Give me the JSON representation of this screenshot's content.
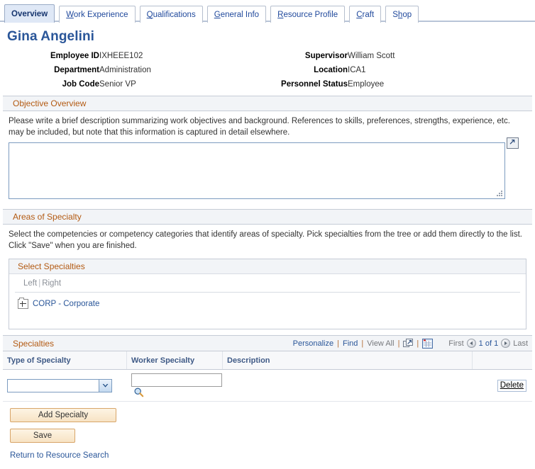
{
  "tabs": [
    {
      "label": "Overview",
      "accesskey_index": -1,
      "selected": true
    },
    {
      "label": "Work Experience",
      "accesskey_index": 0,
      "selected": false
    },
    {
      "label": "Qualifications",
      "accesskey_index": 0,
      "selected": false
    },
    {
      "label": "General Info",
      "accesskey_index": 0,
      "selected": false
    },
    {
      "label": "Resource Profile",
      "accesskey_index": 0,
      "selected": false
    },
    {
      "label": "Craft",
      "accesskey_index": 0,
      "selected": false
    },
    {
      "label": "Shop",
      "accesskey_index": 1,
      "selected": false
    }
  ],
  "page": {
    "title": "Gina Angelini"
  },
  "employee_info": {
    "left": [
      {
        "label": "Employee ID",
        "value": "IXHEEE102"
      },
      {
        "label": "Department",
        "value": "Administration"
      },
      {
        "label": "Job Code",
        "value": "Senior VP"
      }
    ],
    "right": [
      {
        "label": "Supervisor",
        "value": "William Scott"
      },
      {
        "label": "Location",
        "value": "ICA1"
      },
      {
        "label": "Personnel Status",
        "value": "Employee"
      }
    ]
  },
  "objective": {
    "header": "Objective Overview",
    "instructions": "Please write a brief description summarizing work objectives and background. References to skills, preferences, strengths, experience, etc. may be included, but note that this information is captured in detail elsewhere.",
    "textarea_value": "",
    "expand_icon": "expand-window-icon"
  },
  "areas_of_specialty": {
    "header": "Areas of Specialty",
    "instructions": "Select the competencies or competency categories that identify areas of specialty. Pick specialties from the tree or add them directly to the list. Click \"Save\" when you are finished.",
    "select_specialties": {
      "header": "Select Specialties",
      "left_label": "Left",
      "separator": "|",
      "right_label": "Right",
      "tree_nodes": [
        {
          "expand_icon": "plus-box-icon",
          "label": "CORP - Corporate"
        }
      ]
    }
  },
  "specialties_grid": {
    "title": "Specialties",
    "tools": {
      "personalize": "Personalize",
      "find": "Find",
      "view_all": "View All",
      "sep": "|",
      "expand_icon": "expand-grid-icon",
      "download_icon": "download-spreadsheet-icon"
    },
    "pager": {
      "first": "First",
      "prev_icon": "previous-arrow-icon",
      "count": "1 of 1",
      "next_icon": "next-arrow-icon",
      "last": "Last"
    },
    "columns": [
      "Type of Specialty",
      "Worker Specialty",
      "Description",
      ""
    ],
    "rows": [
      {
        "type_of_specialty": "",
        "type_options": [
          ""
        ],
        "worker_specialty": "",
        "lookup_icon": "magnifier-lookup-icon",
        "description": "",
        "delete_label": "Delete"
      }
    ]
  },
  "actions": {
    "add_specialty": "Add Specialty",
    "save": "Save",
    "return_link": "Return to Resource Search"
  },
  "colors": {
    "tab_selected_bg": "#dfe8f6",
    "link_blue": "#2a5699",
    "section_header_text": "#b35a12",
    "section_header_bg": "#f2f4f7",
    "button_bg": "#f7e3c4",
    "button_border": "#d8a569",
    "title_blue": "#2a5699"
  }
}
